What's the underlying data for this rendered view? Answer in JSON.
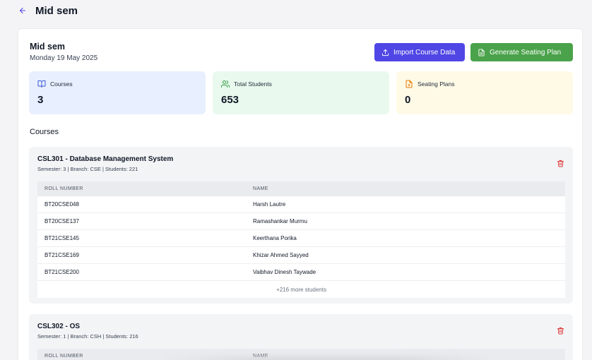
{
  "header": {
    "title": "Mid sem"
  },
  "exam": {
    "title": "Mid sem",
    "date": "Monday 19 May 2025",
    "import_label": "Import Course Data",
    "generate_label": "Generate Seating Plan"
  },
  "stats": {
    "courses": {
      "label": "Courses",
      "value": "3"
    },
    "students": {
      "label": "Total Students",
      "value": "653"
    },
    "plans": {
      "label": "Seating Plans",
      "value": "0"
    }
  },
  "courses_heading": "Courses",
  "courses": [
    {
      "title": "CSL301 - Database Management System",
      "meta": "Semester: 3 | Branch: CSE | Students: 221",
      "columns": [
        "ROLL NUMBER",
        "NAME"
      ],
      "rows": [
        [
          "BT20CSE048",
          "Harsh Lautre"
        ],
        [
          "BT20CSE137",
          "Ramashankar Murmu"
        ],
        [
          "BT21CSE145",
          "Keerthana Porika"
        ],
        [
          "BT21CSE169",
          "Khizar Ahmed Sayyed"
        ],
        [
          "BT21CSE200",
          "Vaibhav Dinesh Taywade"
        ]
      ],
      "more": "+216 more students"
    },
    {
      "title": "CSL302 - OS",
      "meta": "Semester: 1 | Branch: CSH | Students: 216",
      "columns": [
        "ROLL NUMBER",
        "NAME"
      ]
    }
  ],
  "colors": {
    "primary": "#4f46e5",
    "success": "#4aa24a",
    "danger": "#dc2626",
    "courses_bg": "#e8effe",
    "students_bg": "#e9f9ee",
    "plans_bg": "#fefae6"
  },
  "icons": {
    "back": "arrow-left-icon",
    "import": "upload-icon",
    "generate": "file-text-icon",
    "courses": "book-open-icon",
    "students": "users-icon",
    "plans": "file-icon",
    "delete": "trash-icon"
  }
}
